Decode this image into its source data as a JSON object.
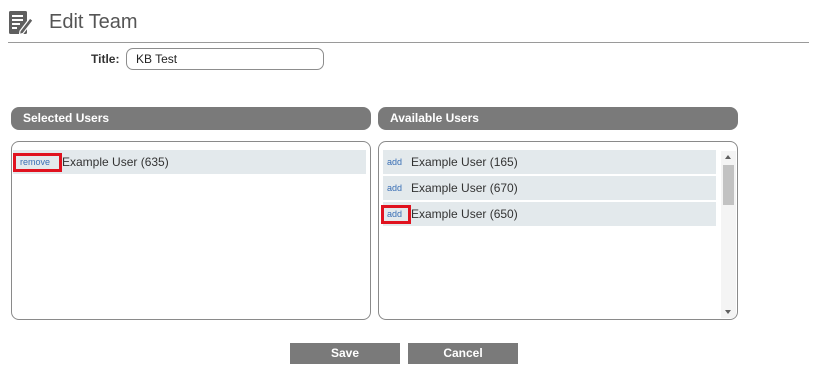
{
  "header": {
    "title": "Edit Team",
    "icon": "edit-document-icon"
  },
  "form": {
    "title_label": "Title:",
    "title_value": "KB Test"
  },
  "selected_users": {
    "label": "Selected Users",
    "items": [
      {
        "action": "remove",
        "name": "Example User (635)"
      }
    ]
  },
  "available_users": {
    "label": "Available Users",
    "items": [
      {
        "action": "add",
        "name": "Example User (165)"
      },
      {
        "action": "add",
        "name": "Example User (670)"
      },
      {
        "action": "add",
        "name": "Example User (650)"
      }
    ]
  },
  "buttons": {
    "save": "Save",
    "cancel": "Cancel"
  },
  "colors": {
    "header_bar": "#7a7a7a",
    "row_bg": "#e3e9ec",
    "link": "#3a6fb5",
    "highlight": "#e0121f"
  }
}
